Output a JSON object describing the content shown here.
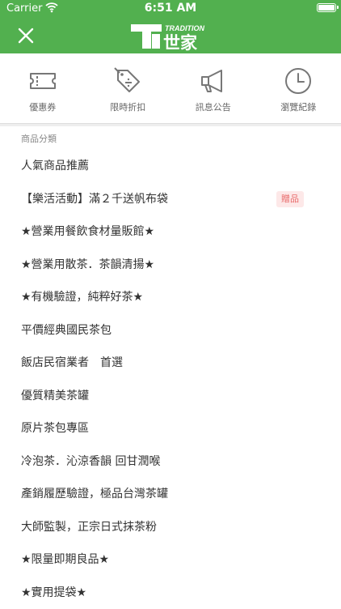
{
  "status_bar": {
    "carrier": "Carrier",
    "time": "6:51 AM"
  },
  "header": {
    "logo_text": "世家",
    "logo_tradition": "TRADITION",
    "bg_color": "#52b04f"
  },
  "quick_links": [
    {
      "label": "優惠券",
      "icon": "ticket-icon"
    },
    {
      "label": "限時折扣",
      "icon": "discount-tag-icon"
    },
    {
      "label": "訊息公告",
      "icon": "megaphone-icon"
    },
    {
      "label": "瀏覽紀錄",
      "icon": "clock-icon"
    }
  ],
  "category_section": {
    "title": "商品分類",
    "items": [
      {
        "label": "人氣商品推薦"
      },
      {
        "label": "【樂活活動】滿２千送帆布袋",
        "badge": "贈品"
      },
      {
        "label": "★營業用餐飲食材量販館★"
      },
      {
        "label": "★營業用散茶．茶韻清揚★"
      },
      {
        "label": "★有機驗證，純粹好茶★"
      },
      {
        "label": "平價經典國民茶包"
      },
      {
        "label": "飯店民宿業者　首選"
      },
      {
        "label": "優質精美茶罐"
      },
      {
        "label": "原片茶包專區"
      },
      {
        "label": "冷泡茶．沁涼香韻 回甘潤喉"
      },
      {
        "label": "產銷履歷驗證，極品台灣茶罐"
      },
      {
        "label": "大師監製，正宗日式抹茶粉"
      },
      {
        "label": "★限量即期良品★"
      },
      {
        "label": "★實用提袋★"
      }
    ]
  }
}
